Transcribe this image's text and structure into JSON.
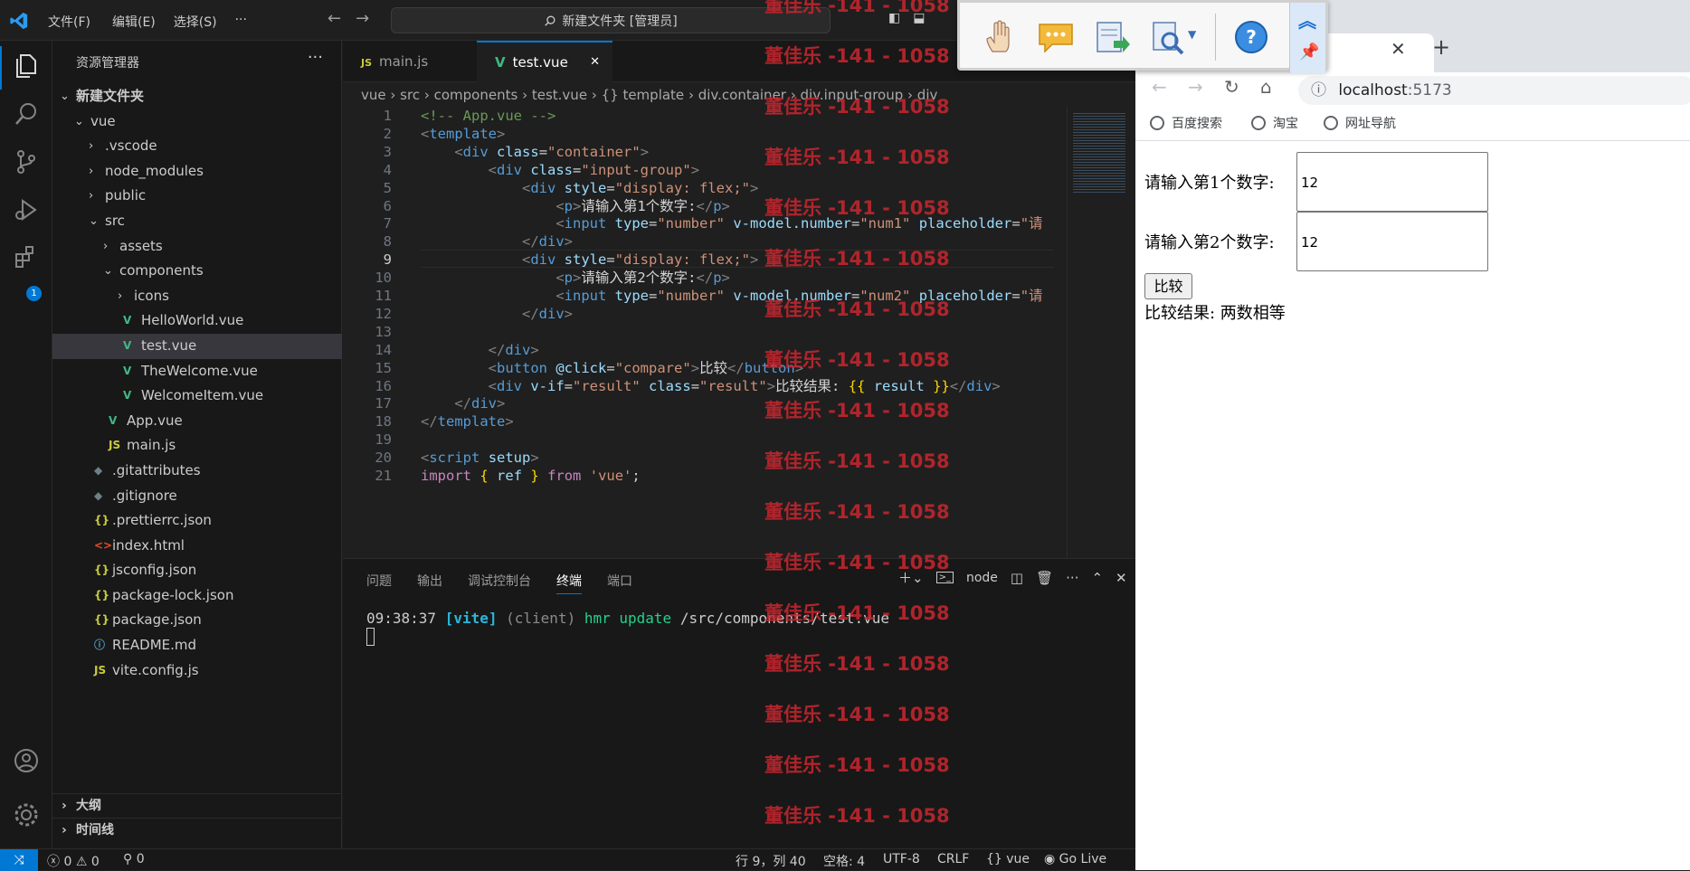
{
  "vscode": {
    "menu": [
      "文件(F)",
      "编辑(E)",
      "选择(S)",
      "···"
    ],
    "command_center": "新建文件夹 [管理员]",
    "explorer_title": "资源管理器",
    "explorer_more": "···",
    "tree": [
      {
        "label": "新建文件夹",
        "depth": 0,
        "expanded": true,
        "bold": true
      },
      {
        "label": "vue",
        "depth": 1,
        "expanded": true
      },
      {
        "label": ".vscode",
        "depth": 2,
        "expanded": false
      },
      {
        "label": "node_modules",
        "depth": 2,
        "expanded": false
      },
      {
        "label": "public",
        "depth": 2,
        "expanded": false
      },
      {
        "label": "src",
        "depth": 2,
        "expanded": true
      },
      {
        "label": "assets",
        "depth": 3,
        "expanded": false
      },
      {
        "label": "components",
        "depth": 3,
        "expanded": true
      },
      {
        "label": "icons",
        "depth": 4,
        "expanded": false
      },
      {
        "label": "HelloWorld.vue",
        "depth": 4,
        "icon": "vue"
      },
      {
        "label": "test.vue",
        "depth": 4,
        "icon": "vue",
        "selected": true
      },
      {
        "label": "TheWelcome.vue",
        "depth": 4,
        "icon": "vue"
      },
      {
        "label": "WelcomeItem.vue",
        "depth": 4,
        "icon": "vue"
      },
      {
        "label": "App.vue",
        "depth": 3,
        "icon": "vue"
      },
      {
        "label": "main.js",
        "depth": 3,
        "icon": "js"
      },
      {
        "label": ".gitattributes",
        "depth": 2,
        "icon": "git"
      },
      {
        "label": ".gitignore",
        "depth": 2,
        "icon": "git"
      },
      {
        "label": ".prettierrc.json",
        "depth": 2,
        "icon": "json"
      },
      {
        "label": "index.html",
        "depth": 2,
        "icon": "html"
      },
      {
        "label": "jsconfig.json",
        "depth": 2,
        "icon": "json"
      },
      {
        "label": "package-lock.json",
        "depth": 2,
        "icon": "json"
      },
      {
        "label": "package.json",
        "depth": 2,
        "icon": "json"
      },
      {
        "label": "README.md",
        "depth": 2,
        "icon": "info"
      },
      {
        "label": "vite.config.js",
        "depth": 2,
        "icon": "js"
      }
    ],
    "outline_label": "大纲",
    "timeline_label": "时间线",
    "tabs": [
      {
        "label": "main.js",
        "icon": "JS",
        "active": false
      },
      {
        "label": "test.vue",
        "icon": "V",
        "active": true,
        "close": "✕"
      }
    ],
    "breadcrumb": [
      "vue",
      "src",
      "components",
      "test.vue",
      "{} template",
      "div.container",
      "div.input-group",
      "div"
    ],
    "current_line": 9,
    "code_lines": [
      "<!-- App.vue -->",
      "<template>",
      "    <div class=\"container\">",
      "        <div class=\"input-group\">",
      "            <div style=\"display: flex;\">",
      "                <p>请输入第1个数字:</p>",
      "                <input type=\"number\" v-model.number=\"num1\" placeholder=\"请",
      "            </div>",
      "            <div style=\"display: flex;\">",
      "                <p>请输入第2个数字:</p>",
      "                <input type=\"number\" v-model.number=\"num2\" placeholder=\"请",
      "            </div>",
      "",
      "        </div>",
      "        <button @click=\"compare\">比较</button>",
      "        <div v-if=\"result\" class=\"result\">比较结果: {{ result }}</div>",
      "    </div>",
      "</template>",
      "",
      "<script setup>",
      "import { ref } from 'vue';"
    ],
    "panel_tabs": [
      "问题",
      "输出",
      "调试控制台",
      "终端",
      "端口"
    ],
    "panel_active_tab": "终端",
    "terminal_shell": "node",
    "terminal_line": {
      "time": "09:38:37",
      "tag": "[vite]",
      "client": "(client)",
      "event": "hmr update",
      "path": "/src/components/test.vue"
    },
    "status": {
      "errors": "0",
      "warnings": "0",
      "ports": "0",
      "position": "行 9，列 40",
      "spaces": "空格: 4",
      "encoding": "UTF-8",
      "eol": "CRLF",
      "language": "vue",
      "golive": "Go Live"
    },
    "extensions_badge": "1"
  },
  "browser": {
    "url_host": "localhost",
    "url_port": ":5173",
    "bookmarks": [
      "百度搜索",
      "淘宝",
      "网址导航"
    ],
    "label1": "请输入第1个数字:",
    "value1": "12",
    "label2": "请输入第2个数字:",
    "value2": "12",
    "button": "比较",
    "result": "比较结果: 两数相等"
  },
  "watermark": "董佳乐 -141 - 1058",
  "colors": {
    "accent": "#0078d4",
    "watermark": "#c4262e",
    "vue_green": "#41b883"
  }
}
